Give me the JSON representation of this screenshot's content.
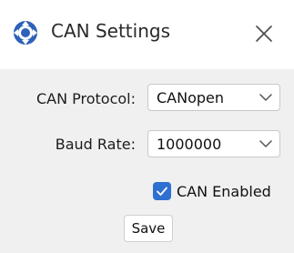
{
  "window": {
    "title": "CAN Settings"
  },
  "icons": {
    "app": "qt-creator-logo-icon",
    "close": "close-icon",
    "dropdown": "chevron-down-icon",
    "check": "check-icon"
  },
  "form": {
    "protocol_label": "CAN Protocol:",
    "protocol_value": "CANopen",
    "baud_label": "Baud Rate:",
    "baud_value": "1000000",
    "enabled_label": "CAN Enabled",
    "enabled_checked": true,
    "save_label": "Save"
  },
  "colors": {
    "accent": "#2f6fd1",
    "titlebar_bg": "#ffffff",
    "window_bg": "#f0f0f0"
  }
}
